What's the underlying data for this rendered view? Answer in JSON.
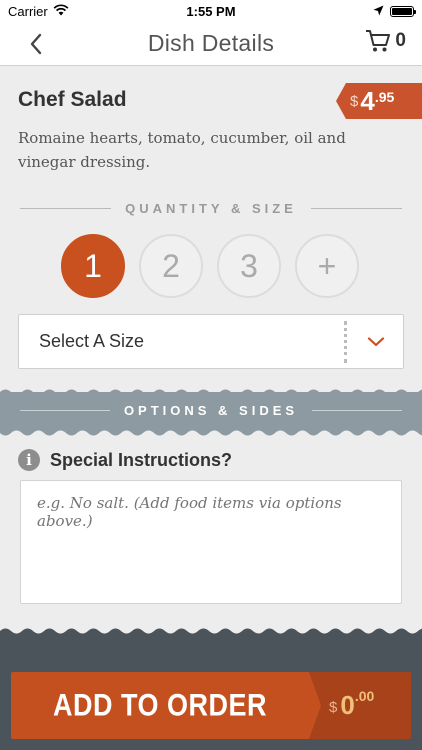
{
  "status_bar": {
    "carrier": "Carrier",
    "time": "1:55 PM"
  },
  "nav": {
    "title": "Dish Details",
    "cart_count": "0"
  },
  "dish": {
    "name": "Chef Salad",
    "price": {
      "currency": "$",
      "dollars": "4",
      "cents": ".95"
    },
    "description": "Romaine hearts, tomato, cucumber, oil and vinegar dressing."
  },
  "quantity": {
    "heading": "QUANTITY & SIZE",
    "options": [
      "1",
      "2",
      "3",
      "+"
    ],
    "selected": "1"
  },
  "size": {
    "label": "Select A Size"
  },
  "options_section": {
    "heading": "OPTIONS & SIDES"
  },
  "instructions": {
    "label": "Special Instructions?",
    "placeholder": "e.g. No salt. (Add food items via options above.)"
  },
  "footer": {
    "button_label": "ADD TO ORDER",
    "total": {
      "currency": "$",
      "dollars": "0",
      "cents": ".00"
    }
  },
  "colors": {
    "accent": "#c9511f",
    "band": "#8e9aa1",
    "footer": "#4c545b"
  }
}
